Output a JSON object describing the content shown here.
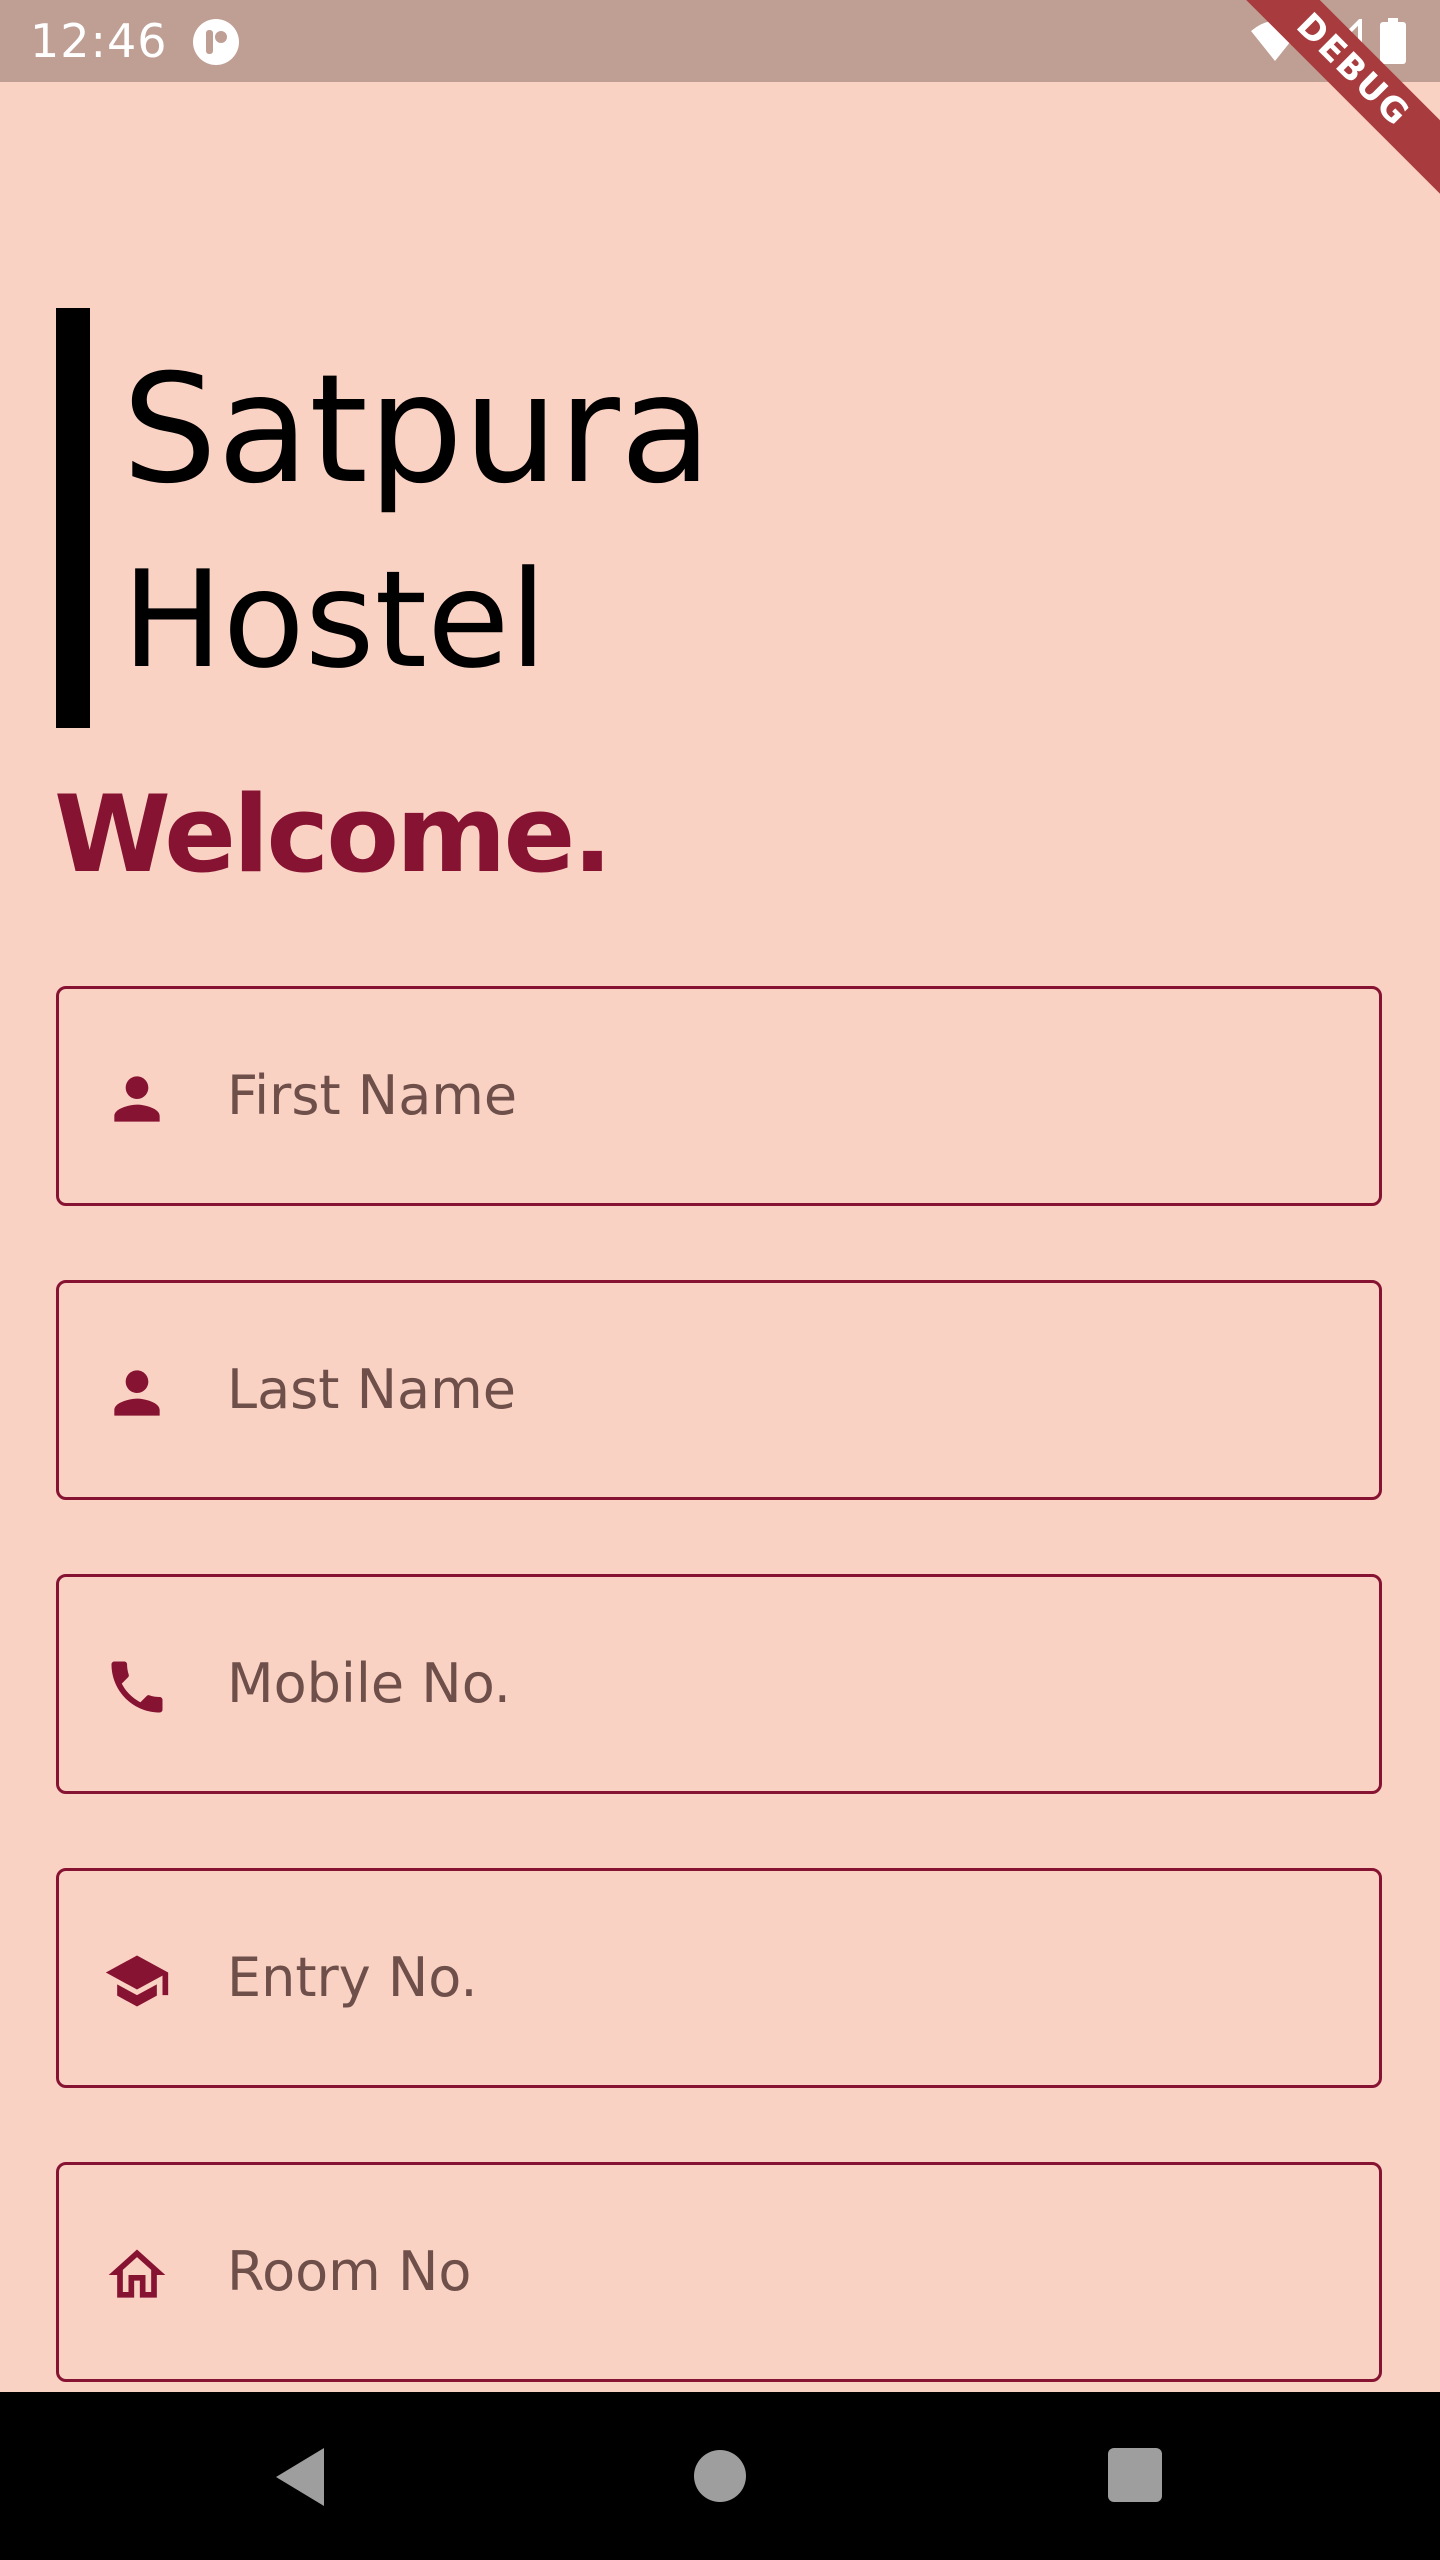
{
  "status_bar": {
    "time": "12:46",
    "icons": [
      "app-notification-icon",
      "wifi-icon",
      "cell-signal-icon",
      "battery-icon"
    ]
  },
  "debug_banner": "DEBUG",
  "header": {
    "title_line1": "Satpura",
    "title_line2": "Hostel",
    "welcome": "Welcome."
  },
  "form": {
    "fields": [
      {
        "icon": "person-icon",
        "placeholder": "First Name"
      },
      {
        "icon": "person-icon",
        "placeholder": "Last Name"
      },
      {
        "icon": "phone-icon",
        "placeholder": "Mobile No."
      },
      {
        "icon": "graduation-cap-icon",
        "placeholder": "Entry No."
      },
      {
        "icon": "home-icon",
        "placeholder": "Room No"
      }
    ]
  },
  "nav": {
    "icons": [
      "back-icon",
      "home-circle-icon",
      "recents-icon"
    ]
  },
  "colors": {
    "background": "#fad2c4",
    "status_bar": "#bf9e94",
    "accent": "#861331",
    "placeholder": "#6e4f4a"
  }
}
